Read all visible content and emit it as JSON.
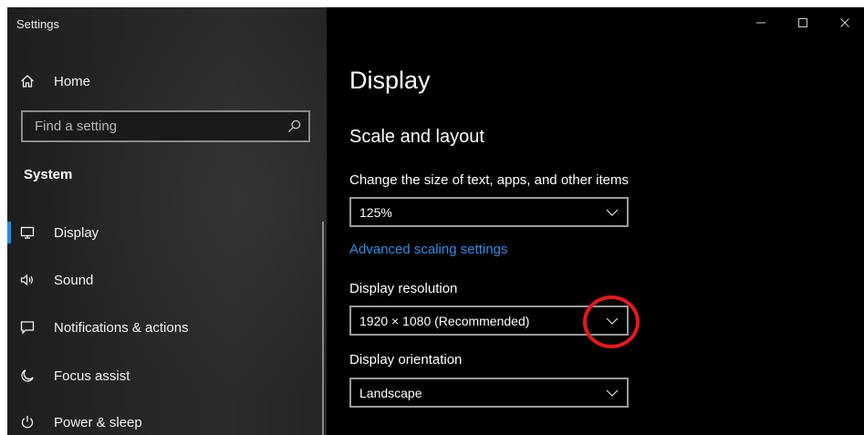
{
  "window": {
    "title": "Settings",
    "controls": {
      "minimize": "minimize-icon",
      "maximize": "maximize-icon",
      "close": "close-icon"
    }
  },
  "sidebar": {
    "home": {
      "label": "Home",
      "icon": "home-icon"
    },
    "search": {
      "placeholder": "Find a setting",
      "value": "",
      "icon": "search-icon"
    },
    "section": "System",
    "items": [
      {
        "label": "Display",
        "icon": "monitor-icon",
        "active": true
      },
      {
        "label": "Sound",
        "icon": "speaker-icon",
        "active": false
      },
      {
        "label": "Notifications & actions",
        "icon": "notification-icon",
        "active": false
      },
      {
        "label": "Focus assist",
        "icon": "moon-icon",
        "active": false
      },
      {
        "label": "Power & sleep",
        "icon": "power-icon",
        "active": false
      }
    ]
  },
  "main": {
    "title": "Display",
    "section_title": "Scale and layout",
    "scale": {
      "label": "Change the size of text, apps, and other items",
      "value": "125%"
    },
    "advanced_link": "Advanced scaling settings",
    "resolution": {
      "label": "Display resolution",
      "value": "1920 × 1080 (Recommended)"
    },
    "orientation": {
      "label": "Display orientation",
      "value": "Landscape"
    }
  },
  "colors": {
    "accent": "#1b8ef2",
    "link": "#2d8ee6",
    "highlight_circle": "#e81818",
    "background": "#000000"
  }
}
